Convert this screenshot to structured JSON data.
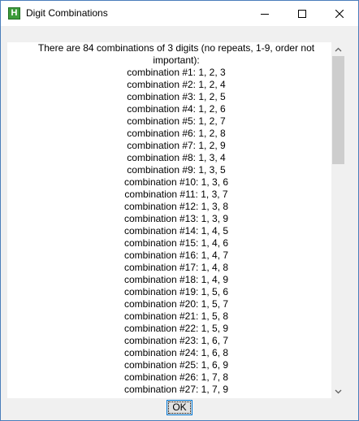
{
  "window": {
    "title": "Digit Combinations",
    "icon_letter": "H",
    "accent_color": "#0078d7"
  },
  "dialog": {
    "header_text": "There are 84 combinations of 3 digits (no repeats, 1-9, order not important):",
    "lines": [
      "combination #1: 1, 2, 3",
      "combination #2: 1, 2, 4",
      "combination #3: 1, 2, 5",
      "combination #4: 1, 2, 6",
      "combination #5: 1, 2, 7",
      "combination #6: 1, 2, 8",
      "combination #7: 1, 2, 9",
      "combination #8: 1, 3, 4",
      "combination #9: 1, 3, 5",
      "combination #10: 1, 3, 6",
      "combination #11: 1, 3, 7",
      "combination #12: 1, 3, 8",
      "combination #13: 1, 3, 9",
      "combination #14: 1, 4, 5",
      "combination #15: 1, 4, 6",
      "combination #16: 1, 4, 7",
      "combination #17: 1, 4, 8",
      "combination #18: 1, 4, 9",
      "combination #19: 1, 5, 6",
      "combination #20: 1, 5, 7",
      "combination #21: 1, 5, 8",
      "combination #22: 1, 5, 9",
      "combination #23: 1, 6, 7",
      "combination #24: 1, 6, 8",
      "combination #25: 1, 6, 9",
      "combination #26: 1, 7, 8",
      "combination #27: 1, 7, 9"
    ],
    "ok_label": "OK"
  },
  "icons": {
    "minimize": "minimize-icon",
    "maximize": "maximize-icon",
    "close": "close-icon",
    "scroll_up": "chevron-up-icon",
    "scroll_down": "chevron-down-icon"
  }
}
